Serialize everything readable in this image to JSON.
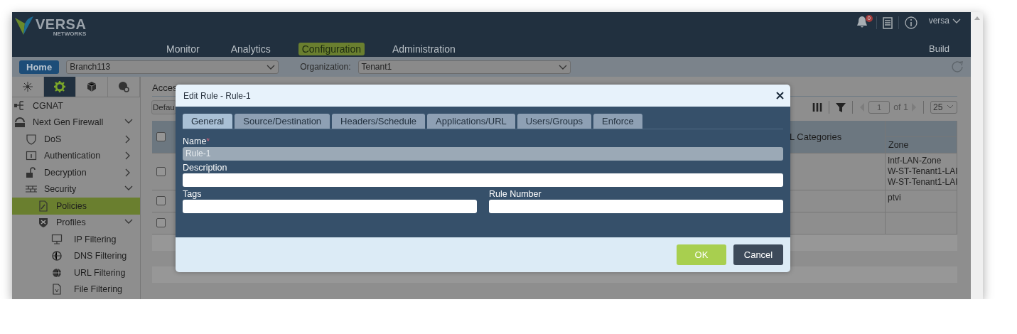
{
  "header": {
    "logo": {
      "name": "VERSA",
      "sub": "NETWORKS"
    },
    "nav": [
      {
        "label": "Monitor",
        "selected": false
      },
      {
        "label": "Analytics",
        "selected": false
      },
      {
        "label": "Configuration",
        "selected": true
      },
      {
        "label": "Administration",
        "selected": false
      }
    ],
    "notifications": "0",
    "user": "versa",
    "build": "Build"
  },
  "toolbar": {
    "home": "Home",
    "appliance": "Branch113",
    "organization_label": "Organization:",
    "organization": "Tenant1"
  },
  "sidebar": {
    "tabs": [
      {
        "selected": false
      },
      {
        "selected": true
      },
      {
        "selected": false
      },
      {
        "selected": false
      }
    ],
    "tree": [
      {
        "label": "CGNAT",
        "selected": false
      },
      {
        "label": "Next Gen Firewall",
        "selected": false,
        "expanded": true,
        "children": [
          {
            "label": "DoS",
            "selected": false,
            "expanded": false
          },
          {
            "label": "Authentication",
            "selected": false,
            "expanded": false
          },
          {
            "label": "Decryption",
            "selected": false,
            "expanded": false
          },
          {
            "label": "Security",
            "selected": false,
            "expanded": true,
            "children": [
              {
                "label": "Policies",
                "selected": true
              },
              {
                "label": "Profiles",
                "selected": false,
                "expanded": true,
                "children": [
                  {
                    "label": "IP Filtering",
                    "selected": false
                  },
                  {
                    "label": "DNS Filtering",
                    "selected": false
                  },
                  {
                    "label": "URL Filtering",
                    "selected": false
                  },
                  {
                    "label": "File Filtering",
                    "selected": false
                  }
                ]
              }
            ]
          }
        ]
      }
    ]
  },
  "main": {
    "title": "Acces",
    "filter": "Defau",
    "pager": {
      "page": "1",
      "of": "of 1",
      "page_size": "25"
    },
    "table": {
      "header_checked": false,
      "columns": [
        "L Categories",
        "Zone"
      ],
      "rows": [
        {
          "checked": false,
          "zone": [
            "Intf-LAN-Zone",
            "W-ST-Tenant1-LAI",
            "W-ST-Tenant1-LAI"
          ]
        },
        {
          "checked": false,
          "zone": [
            "ptvi"
          ]
        },
        {
          "checked": false
        }
      ]
    }
  },
  "dialog": {
    "title": "Edit Rule - Rule-1",
    "tabs": [
      {
        "label": "General",
        "selected": true
      },
      {
        "label": "Source/Destination",
        "selected": false
      },
      {
        "label": "Headers/Schedule",
        "selected": false
      },
      {
        "label": "Applications/URL",
        "selected": false
      },
      {
        "label": "Users/Groups",
        "selected": false
      },
      {
        "label": "Enforce",
        "selected": false
      }
    ],
    "rows": [
      [
        {
          "label": "Name",
          "required_mark": "*",
          "value": "Rule-1",
          "disabled": true
        }
      ],
      [
        {
          "label": "Description",
          "disabled": false
        }
      ],
      [
        {
          "label": "Tags",
          "disabled": false
        },
        {
          "label": "Rule Number",
          "disabled": false
        }
      ]
    ],
    "buttons": [
      {
        "label": "OK",
        "kind": "primary"
      },
      {
        "label": "Cancel",
        "kind": "secondary"
      }
    ]
  }
}
